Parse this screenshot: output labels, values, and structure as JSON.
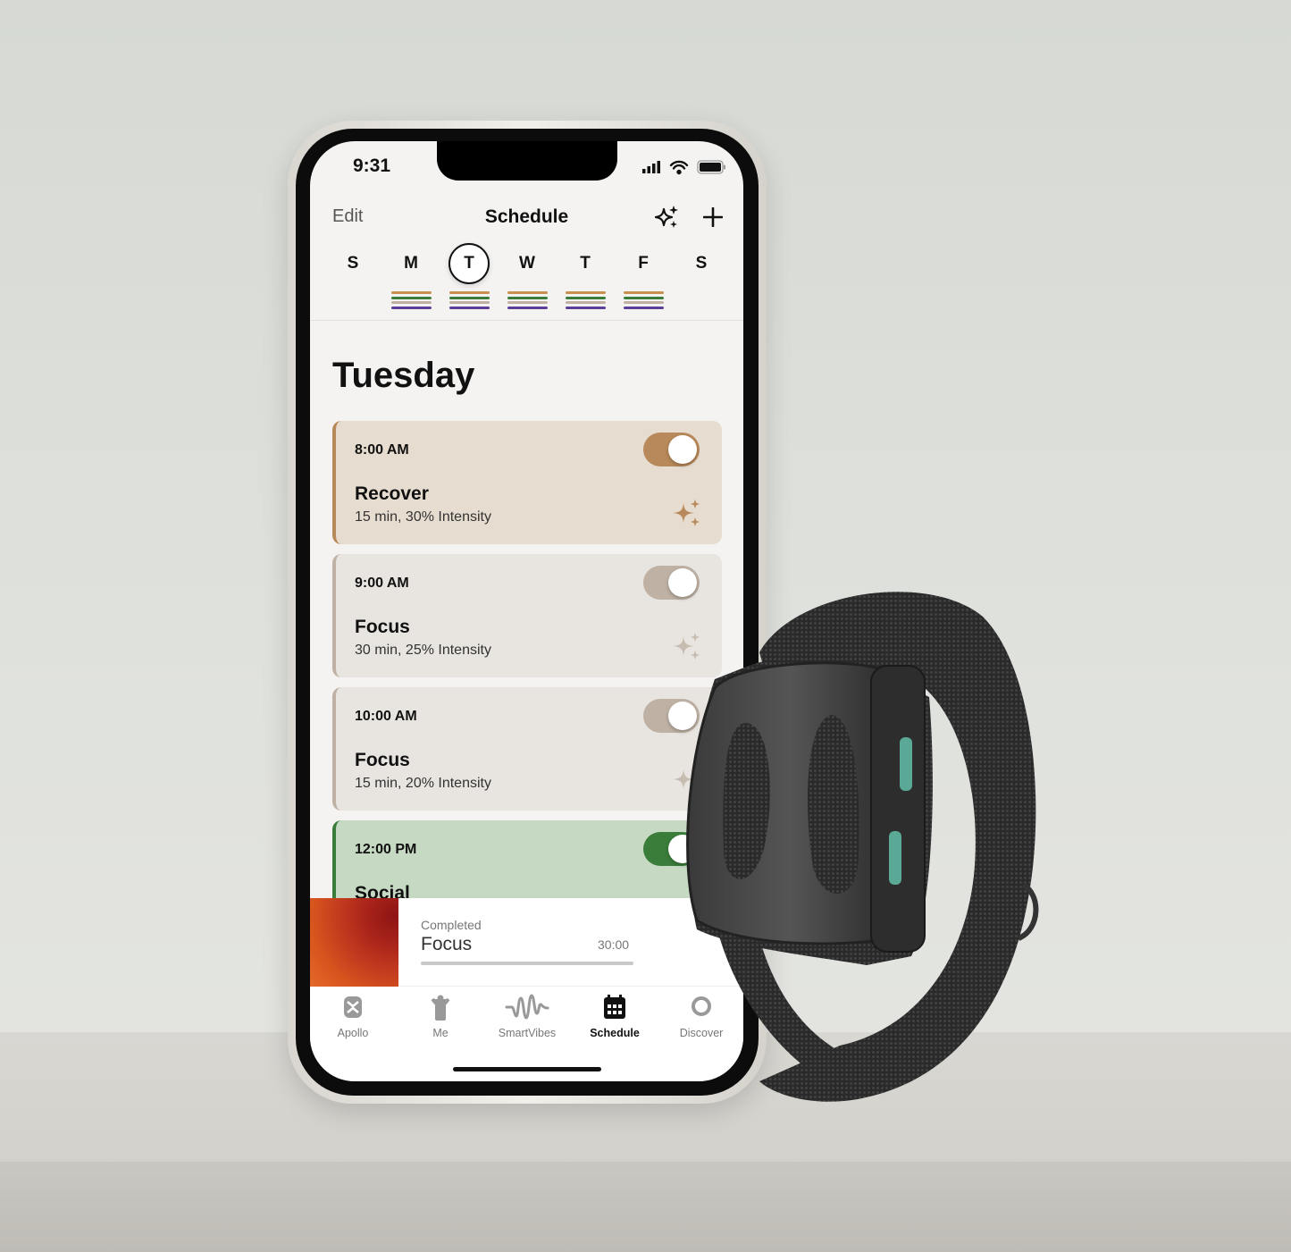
{
  "status_bar": {
    "time": "9:31"
  },
  "header": {
    "edit_label": "Edit",
    "title": "Schedule",
    "icons": [
      "sparkles-icon",
      "plus-icon"
    ]
  },
  "week": {
    "days": [
      "S",
      "M",
      "T",
      "W",
      "T",
      "F",
      "S"
    ],
    "selected_index": 2,
    "days_with_sessions": [
      1,
      2,
      3,
      4,
      5
    ],
    "stripe_colors": [
      "#c8914f",
      "#3a7d3a",
      "#bfb2a4",
      "#5b3f9a"
    ]
  },
  "day_title": "Tuesday",
  "sessions": [
    {
      "time": "8:00 AM",
      "name": "Recover",
      "details": "15 min, 30% Intensity",
      "enabled": true,
      "bg": "#e6ddd0",
      "accent": "#b8895a"
    },
    {
      "time": "9:00 AM",
      "name": "Focus",
      "details": "30 min, 25% Intensity",
      "enabled": false,
      "bg": "#e8e5e1",
      "accent": "#bfb2a4"
    },
    {
      "time": "10:00 AM",
      "name": "Focus",
      "details": "15 min, 20% Intensity",
      "enabled": false,
      "bg": "#e8e5e1",
      "accent": "#bfb2a4"
    },
    {
      "time": "12:00 PM",
      "name": "Social",
      "details": "",
      "enabled": true,
      "bg": "#c6d9c3",
      "accent": "#3a7d3a"
    }
  ],
  "player": {
    "status": "Completed",
    "title": "Focus",
    "duration": "30:00",
    "progress": 1.0
  },
  "tabs": [
    {
      "label": "Apollo",
      "icon": "apollo-device-icon"
    },
    {
      "label": "Me",
      "icon": "person-icon"
    },
    {
      "label": "SmartVibes",
      "icon": "waveform-icon"
    },
    {
      "label": "Schedule",
      "icon": "calendar-icon",
      "active": true
    },
    {
      "label": "Discover",
      "icon": "discover-icon"
    }
  ]
}
